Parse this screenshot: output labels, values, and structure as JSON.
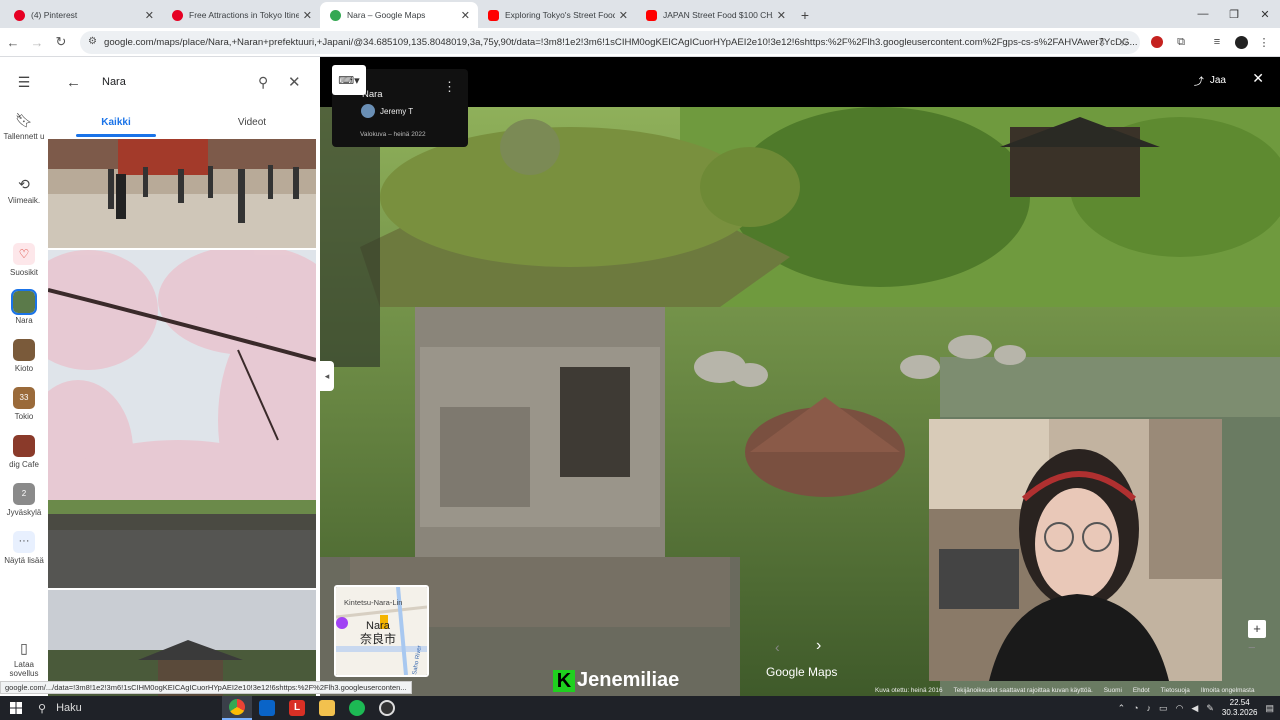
{
  "tabs": [
    {
      "title": "(4) Pinterest",
      "color": "#e60023",
      "active": false
    },
    {
      "title": "Free Attractions in Tokyo Itinera",
      "color": "#e60023",
      "active": false
    },
    {
      "title": "Nara – Google Maps",
      "color": "#34a853",
      "active": true
    },
    {
      "title": "Exploring Tokyo's Street Food W",
      "color": "#ff0000",
      "active": false
    },
    {
      "title": "JAPAN Street Food $100 CHALL",
      "color": "#ff0000",
      "active": false
    }
  ],
  "address": {
    "url": "google.com/maps/place/Nara,+Naran+prefektuuri,+Japani/@34.685109,135.8048019,3a,75y,90t/data=!3m8!1e2!3m6!1sCIHM0ogKEICAgICuorHYpAEI2e10!3e12!6shttps:%2F%2Flh3.googleusercontent.com%2Fgps-cs-s%2FAHVAwer7YcDG..."
  },
  "rail": {
    "items": [
      {
        "label": "Tallennett u",
        "icon": "bookmark-icon"
      },
      {
        "label": "Viimeaik.",
        "icon": "history-icon"
      },
      {
        "label": "Suosikit",
        "icon": "heart-icon"
      },
      {
        "label": "Nara",
        "icon": "thumb"
      },
      {
        "label": "Kioto",
        "icon": "thumb"
      },
      {
        "label": "Tokio",
        "icon": "thumb",
        "badge": "33"
      },
      {
        "label": "dig Cafe",
        "icon": "thumb"
      },
      {
        "label": "Jyväskylä",
        "icon": "thumb",
        "badge": "2"
      },
      {
        "label": "Näytä lisää",
        "icon": "more-icon"
      },
      {
        "label": "Lataa sovellus",
        "icon": "phone-icon"
      }
    ]
  },
  "panel": {
    "search_value": "Nara",
    "tabs": [
      "Kaikki",
      "Videot"
    ]
  },
  "viewer": {
    "title": "Nara",
    "author": "Jeremy T",
    "date": "Valokuva – heinä 2022",
    "share_label": "Jaa",
    "brand": "Jenemiliae",
    "brand_initial": "K",
    "maps_logo": "Google Maps",
    "minimap": {
      "place_latin": "Nara",
      "place_jp": "奈良市",
      "street": "Kintetsu-Nara-Lin",
      "river": "Saho River"
    },
    "footer": [
      "Kuva otettu: heinä 2016",
      "Tekijänoikeudet saattavat rajoittaa kuvan käyttöä.",
      "Suomi",
      "Ehdot",
      "Tietosuoja",
      "Ilmoita ongelmasta"
    ]
  },
  "status_url": "google.com/.../data=!3m8!1e2!3m6!1sCIHM0ogKEICAgICuorHYpAEI2e10!3e12!6shttps:%2F%2Flh3.googleuserconten...",
  "taskbar": {
    "search_label": "Haku",
    "time": "22.54",
    "date": "30.3.2026"
  }
}
